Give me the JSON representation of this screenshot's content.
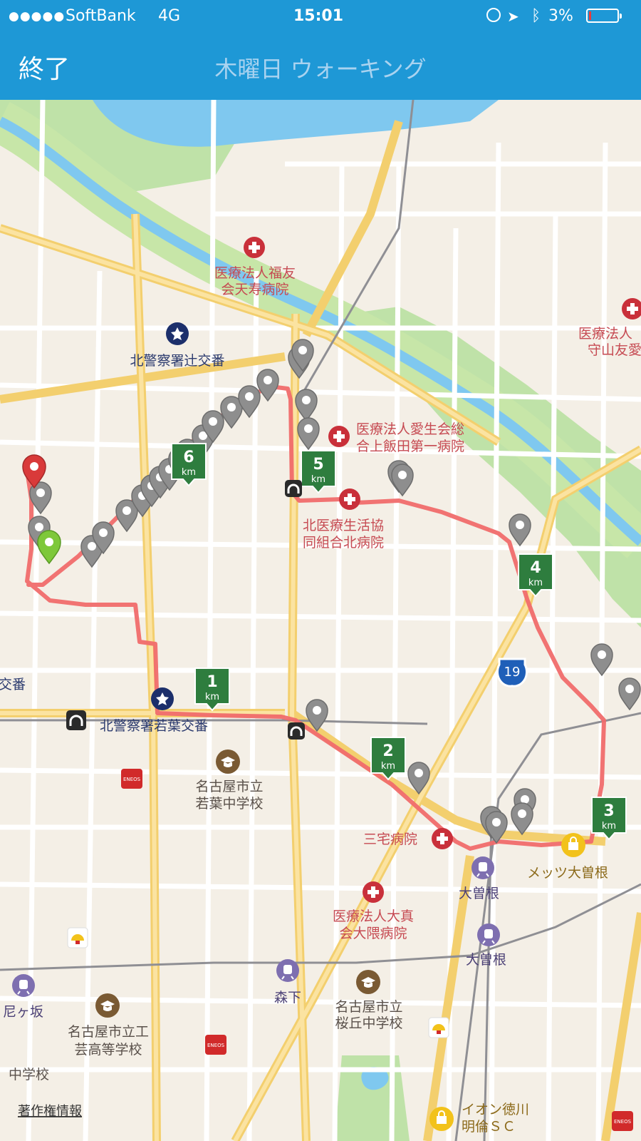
{
  "status_bar": {
    "carrier": "SoftBank",
    "network": "4G",
    "time": "15:01",
    "battery": "3%",
    "signal_dots": 5
  },
  "nav": {
    "done_label": "終了",
    "title": "木曜日 ウォーキング"
  },
  "colors": {
    "bar": "#1e98d6",
    "route": "#f06b6b",
    "km_marker": "#2e7d3e",
    "start_pin": "#7ec83a",
    "end_pin": "#d93a3a",
    "waypoint_pin": "#8e8e8e",
    "river": "#7fc8ef",
    "park": "#b7dea0"
  },
  "map": {
    "km_markers": [
      {
        "value": "1",
        "unit": "km"
      },
      {
        "value": "2",
        "unit": "km"
      },
      {
        "value": "3",
        "unit": "km"
      },
      {
        "value": "4",
        "unit": "km"
      },
      {
        "value": "5",
        "unit": "km"
      },
      {
        "value": "6",
        "unit": "km"
      }
    ],
    "labels": {
      "hosp_fukuyu_1": "医療法人福友",
      "hosp_fukuyu_2": "会天寿病院",
      "hosp_moriyama_1": "医療法人",
      "hosp_moriyama_2": "守山友愛",
      "police_tsuji": "北警察署辻交番",
      "hosp_aisei_1": "医療法人愛生会総",
      "hosp_aisei_2": "合上飯田第一病院",
      "hosp_kita_1": "北医療生活協",
      "hosp_kita_2": "同組合北病院",
      "koban_left": "交番",
      "police_wakaba": "北警察署若葉交番",
      "school_wakaba_1": "名古屋市立",
      "school_wakaba_2": "若葉中学校",
      "hosp_miyake": "三宅病院",
      "mets": "メッツ大曽根",
      "station_ozone_1": "大曽根",
      "station_ozone_2": "大曽根",
      "hosp_oguma_1": "医療法人大真",
      "hosp_oguma_2": "会大隈病院",
      "station_morishita": "森下",
      "station_amagasaka": "尼ヶ坂",
      "school_geiko_1": "名古屋市立工",
      "school_geiko_2": "芸高等学校",
      "school_sakuragaoka_1": "名古屋市立",
      "school_sakuragaoka_2": "桜丘中学校",
      "school_bottom_left": "中学校",
      "aeon_1": "イオン徳川",
      "aeon_2": "明倫ＳＣ",
      "copyright": "著作権情報",
      "route_shield": "19",
      "eneos": "ENEOS"
    }
  }
}
